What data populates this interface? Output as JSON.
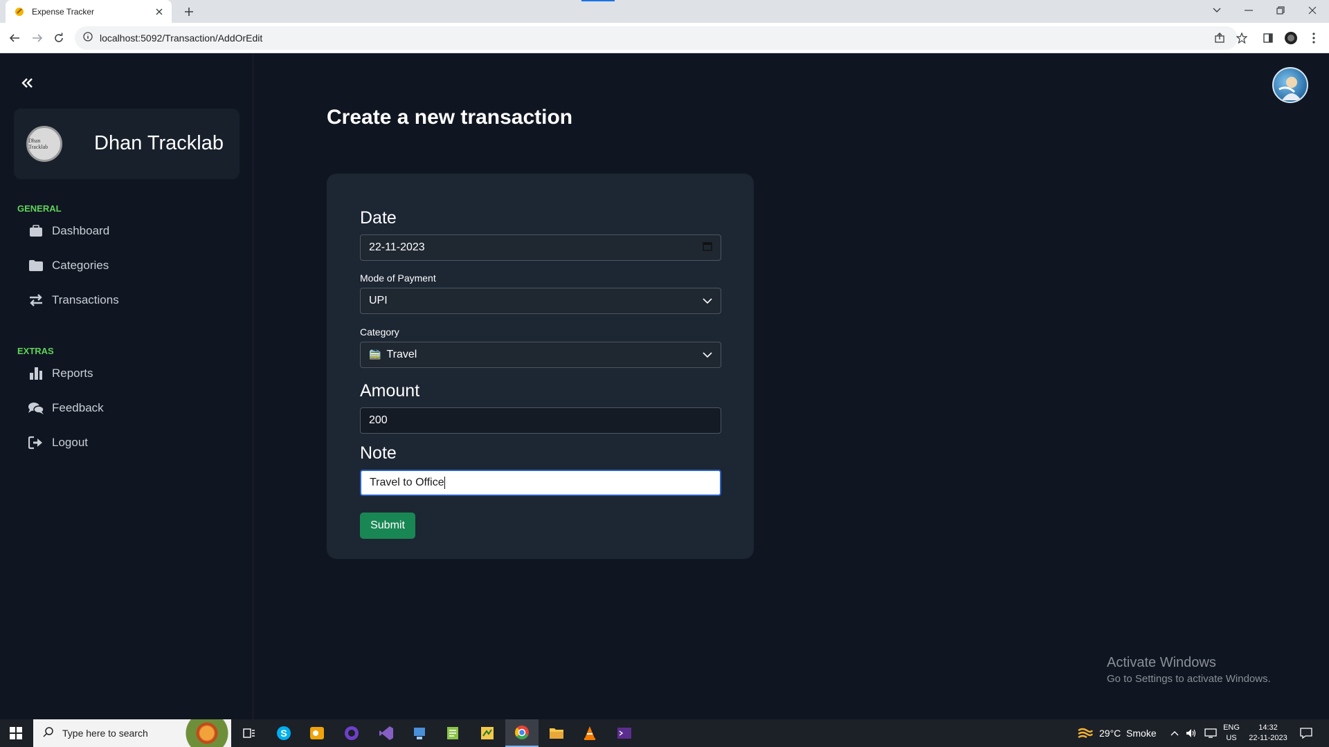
{
  "browser": {
    "tab_title": "Expense Tracker",
    "url": "localhost:5092/Transaction/AddOrEdit"
  },
  "sidebar": {
    "brand_name": "Dhan Tracklab",
    "brand_logo_text": "Dhan Tracklab",
    "general_title": "GENERAL",
    "extras_title": "EXTRAS",
    "general_items": [
      {
        "label": "Dashboard",
        "icon": "dashboard-icon"
      },
      {
        "label": "Categories",
        "icon": "folder-icon"
      },
      {
        "label": "Transactions",
        "icon": "arrows-exchange-icon"
      }
    ],
    "extras_items": [
      {
        "label": "Reports",
        "icon": "bar-chart-icon"
      },
      {
        "label": "Feedback",
        "icon": "comments-icon"
      },
      {
        "label": "Logout",
        "icon": "logout-icon"
      }
    ]
  },
  "main": {
    "page_title": "Create a new transaction",
    "form": {
      "date_label": "Date",
      "date_value": "22-11-2023",
      "payment_label": "Mode of Payment",
      "payment_value": "UPI",
      "category_label": "Category",
      "category_icon": "🚞",
      "category_value": "Travel",
      "amount_label": "Amount",
      "amount_value": "200",
      "note_label": "Note",
      "note_value": "Travel to Office",
      "submit_label": "Submit"
    }
  },
  "watermark": {
    "title": "Activate Windows",
    "subtitle": "Go to Settings to activate Windows."
  },
  "taskbar": {
    "search_placeholder": "Type here to search",
    "weather": "29°C  Smoke",
    "lang_top": "ENG",
    "lang_bottom": "US",
    "time": "14:32",
    "date": "22-11-2023"
  },
  "colors": {
    "accent_green": "#5fd35a",
    "submit_green": "#198754",
    "app_background": "#101621",
    "card_background": "#1d2633"
  }
}
